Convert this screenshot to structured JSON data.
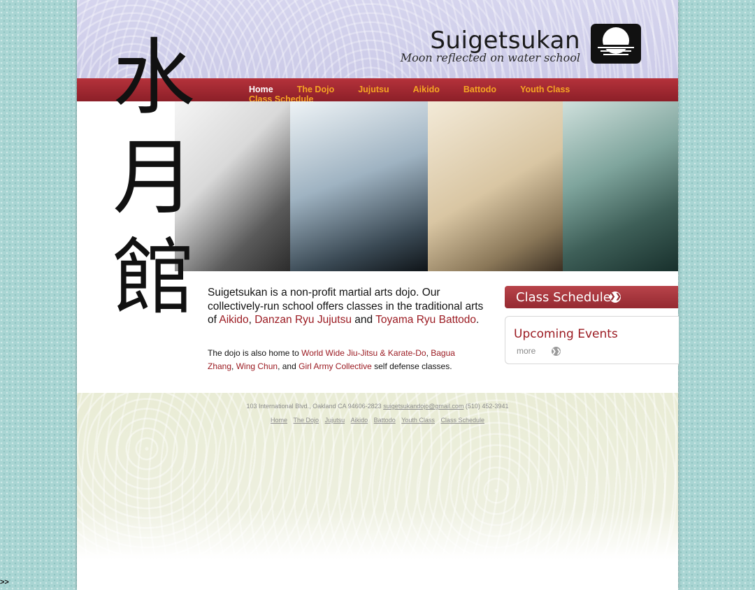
{
  "site": {
    "title": "Suigetsukan",
    "subtitle": "Moon reflected on water school",
    "kanji": [
      "水",
      "月",
      "館"
    ]
  },
  "nav": {
    "items": [
      "Home",
      "The Dojo",
      "Jujutsu",
      "Aikido",
      "Battodo",
      "Youth Class",
      "Class Schedule"
    ],
    "active": "Home"
  },
  "intro": {
    "part1": "Suigetsukan is a non-profit martial arts dojo. Our collectively-run school offers classes in the traditional arts of ",
    "link_aikido": "Aikido",
    "sep1": ", ",
    "link_danzan": "Danzan Ryu Jujutsu",
    "sep2": " and ",
    "link_toyama": "Toyama Ryu Battodo",
    "end": "."
  },
  "secondary": {
    "part1": "The dojo is also home to ",
    "link_wwjj": "World Wide Jiu-Jitsu & Karate-Do",
    "sep1": ", ",
    "link_bagua": "Bagua Zhang",
    "sep2": ", ",
    "link_wingchun": "Wing Chun",
    "sep3": ", and ",
    "link_girlarmy": "Girl Army Collective",
    "end": " self defense classes."
  },
  "sidebar": {
    "schedule_button": "Class Schedule",
    "events_title": "Upcoming Events",
    "events_more": "more"
  },
  "footer": {
    "address": "103 International Blvd., Oakland CA 94606-2823",
    "email": "suigetsukandojo@gmail.com",
    "phone": "(510) 452-3941",
    "links": [
      "Home",
      "The Dojo",
      "Jujutsu",
      "Aikido",
      "Battodo",
      "Youth Class",
      "Class Schedule"
    ]
  },
  "corner_marker": ">>",
  "colors": {
    "nav_bg": "#9b2a32",
    "nav_text": "#f5a623",
    "accent_red": "#9b1b22",
    "outer_bg": "#a9d5d3"
  }
}
